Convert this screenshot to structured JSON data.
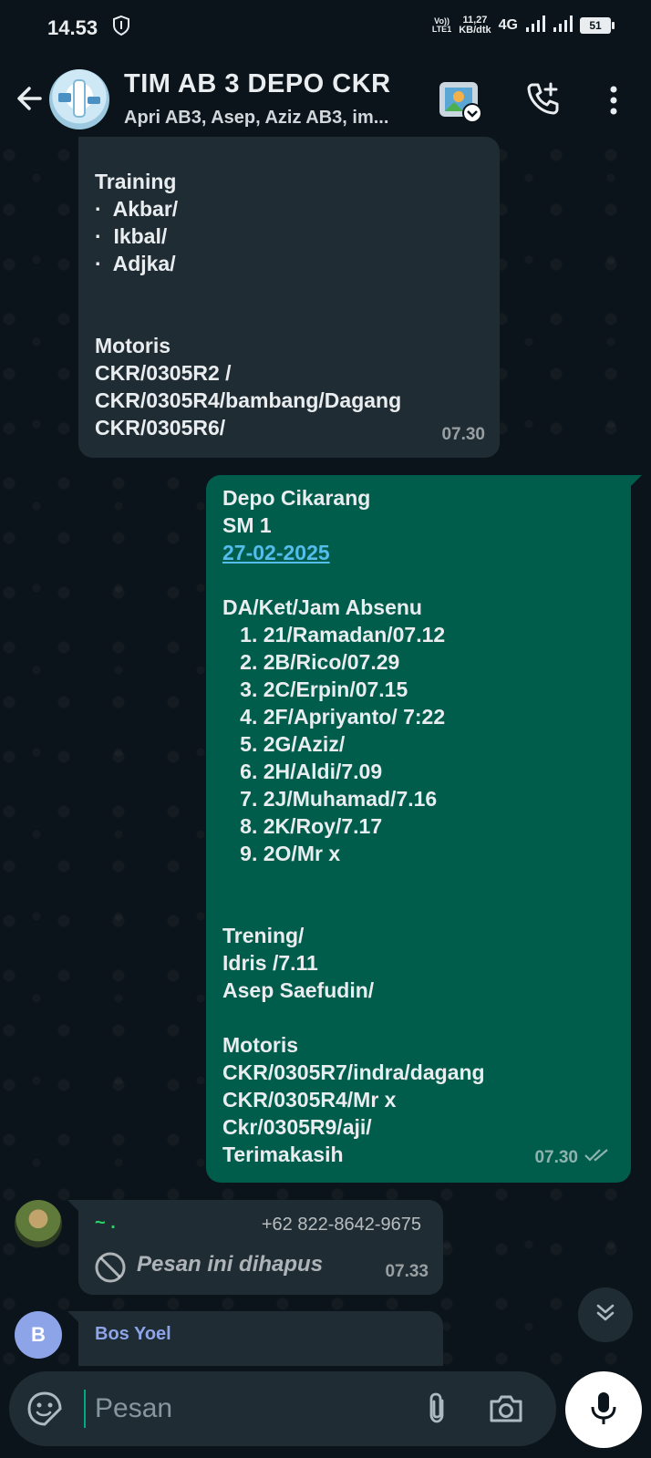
{
  "status_bar": {
    "time": "14.53",
    "volte_top": "Vo))",
    "volte_bottom": "LTE1",
    "speed_value": "11,27",
    "speed_unit": "KB/dtk",
    "network": "4G",
    "battery": "51"
  },
  "header": {
    "title": "TIM AB 3 DEPO CKR",
    "subtitle": "Apri AB3, Asep, Aziz AB3, im..."
  },
  "messages": {
    "m1": {
      "lines": [
        "Training",
        "·  Akbar/",
        "·  Ikbal/",
        "·  Adjka/",
        "",
        "",
        "Motoris",
        "CKR/0305R2 /",
        "CKR/0305R4/bambang/Dagang",
        "CKR/0305R6/"
      ],
      "time": "07.30"
    },
    "m2": {
      "line_0": "Depo Cikarang",
      "line_1": "SM 1",
      "date": "27-02-2025",
      "lines": [
        "",
        "DA/Ket/Jam Absenu",
        "   1. 21/Ramadan/07.12",
        "   2. 2B/Rico/07.29",
        "   3. 2C/Erpin/07.15",
        "   4. 2F/Apriyanto/ 7:22",
        "   5. 2G/Aziz/",
        "   6. 2H/Aldi/7.09",
        "   7. 2J/Muhamad/7.16",
        "   8. 2K/Roy/7.17",
        "   9. 2O/Mr x",
        "",
        "",
        "Trening/",
        "Idris /7.11",
        "Asep Saefudin/",
        "",
        "Motoris",
        "CKR/0305R7/indra/dagang",
        "CKR/0305R4/Mr x",
        "Ckr/0305R9/aji/",
        "Terimakasih"
      ],
      "time": "07.30"
    },
    "m3": {
      "sender": "~ .",
      "phone": "+62 822-8642-9675",
      "text": "Pesan ini dihapus",
      "time": "07.33"
    },
    "m4": {
      "avatar_letter": "B",
      "sender": "Bos Yoel"
    }
  },
  "input": {
    "placeholder": "Pesan"
  },
  "colors": {
    "background": "#0b141a",
    "incoming": "#202c33",
    "outgoing": "#005c4b",
    "accent": "#00a884",
    "link": "#53bdeb"
  },
  "icons": {
    "back": "arrow-left-icon",
    "call": "phone-add-icon",
    "menu": "more-vertical-icon",
    "meet": "image-badge-icon",
    "deleted": "block-icon",
    "scroll": "double-chevron-down-icon",
    "sticker": "sticker-icon",
    "attach": "paperclip-icon",
    "camera": "camera-icon",
    "mic": "microphone-icon"
  }
}
